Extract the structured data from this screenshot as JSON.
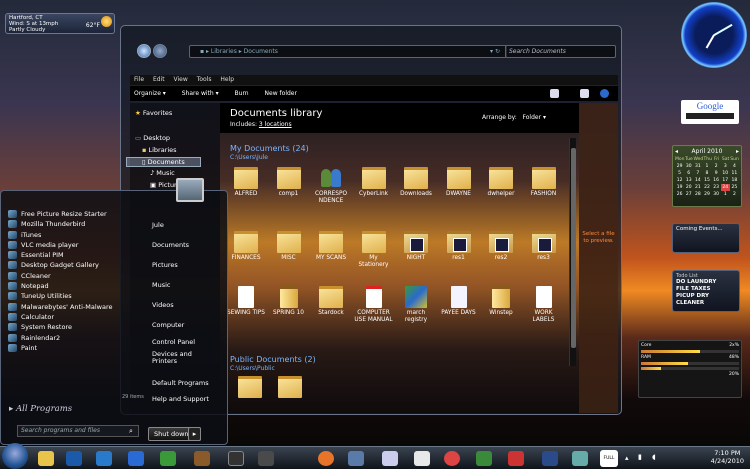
{
  "weather": {
    "city": "Hartford, CT",
    "wind": "Wind: S at 13mph",
    "condition": "Partly Cloudy",
    "temp": "62°F"
  },
  "google": {
    "label": "Google"
  },
  "calendar": {
    "month": "April  2010",
    "dow": [
      "Mon",
      "Tue",
      "Wed",
      "Thu",
      "Fri",
      "Sat",
      "Sun"
    ],
    "rows": [
      [
        "29",
        "30",
        "31",
        "1",
        "2",
        "3",
        "4"
      ],
      [
        "5",
        "6",
        "7",
        "8",
        "9",
        "10",
        "11"
      ],
      [
        "12",
        "13",
        "14",
        "15",
        "16",
        "17",
        "18"
      ],
      [
        "19",
        "20",
        "21",
        "22",
        "23",
        "24",
        "25"
      ],
      [
        "26",
        "27",
        "28",
        "29",
        "30",
        "1",
        "2"
      ]
    ],
    "today": "24"
  },
  "coming": {
    "title": "Coming Events..."
  },
  "todo": {
    "title": "Todo List",
    "items": [
      "DO LAUNDRY",
      "FILE TAXES",
      "PICUP DRY CLEANER"
    ]
  },
  "meter": {
    "cpu_label": "Core",
    "cpu_value": "2x%",
    "ram_label": "RAM",
    "ram_value": "48%",
    "disk_value": "20%",
    "cpu_level": 0.6,
    "ram_level": 0.48,
    "disk_level": 0.2
  },
  "explorer": {
    "address": [
      "Libraries",
      "Documents"
    ],
    "search_placeholder": "Search Documents",
    "menu": [
      "File",
      "Edit",
      "View",
      "Tools",
      "Help"
    ],
    "toolbar": [
      "Organize ▾",
      "Share with ▾",
      "Burn",
      "New folder"
    ],
    "nav": {
      "favorites": "Favorites",
      "desktop": "Desktop",
      "libraries": "Libraries",
      "documents": "Documents",
      "music": "Music",
      "pictures": "Pictur"
    },
    "library_title": "Documents library",
    "library_sub": "Includes:",
    "library_locations": "3 locations",
    "arrange_label": "Arrange by:",
    "arrange_value": "Folder",
    "section1": "My Documents (24)",
    "path1": "C:\\Users\\Jule",
    "section2": "Public Documents (2)",
    "path2": "C:\\Users\\Public",
    "files": [
      {
        "name": "ALFRED",
        "kind": "folder"
      },
      {
        "name": "comp1",
        "kind": "folder"
      },
      {
        "name": "CORRESPO NDENCE",
        "kind": "ppl"
      },
      {
        "name": "CyberLink",
        "kind": "folder"
      },
      {
        "name": "Downloads",
        "kind": "folder"
      },
      {
        "name": "DWAYNE",
        "kind": "folder"
      },
      {
        "name": "dwhelper",
        "kind": "folder"
      },
      {
        "name": "FASHION",
        "kind": "folder"
      },
      {
        "name": "FINANCES",
        "kind": "folder"
      },
      {
        "name": "MISC",
        "kind": "folder"
      },
      {
        "name": "MY SCANS",
        "kind": "folder"
      },
      {
        "name": "My Stationery",
        "kind": "folder"
      },
      {
        "name": "NIGHT",
        "kind": "vid"
      },
      {
        "name": "res1",
        "kind": "vid"
      },
      {
        "name": "res2",
        "kind": "vid"
      },
      {
        "name": "res3",
        "kind": "vid"
      },
      {
        "name": "SEWING TIPS",
        "kind": "doc"
      },
      {
        "name": "SPRING 10",
        "kind": "zip"
      },
      {
        "name": "Stardock",
        "kind": "folder"
      },
      {
        "name": "COMPUTER USE MANUAL",
        "kind": "pdf"
      },
      {
        "name": "march registry",
        "kind": "prog"
      },
      {
        "name": "PAYEE DAYS",
        "kind": "pay"
      },
      {
        "name": "Winstep",
        "kind": "zip"
      },
      {
        "name": "WORK LABELS",
        "kind": "doc"
      }
    ],
    "preview": "Select a file to preview.",
    "status": "29 items"
  },
  "start": {
    "pinned": [
      "Free Picture Resize Starter",
      "Mozilla Thunderbird",
      "iTunes",
      "VLC media player",
      "Essential PIM",
      "Desktop Gadget Gallery",
      "CCleaner",
      "Notepad",
      "TuneUp Utilities",
      "Malwarebytes' Anti-Malware",
      "Calculator",
      "System Restore",
      "Rainlendar2",
      "Paint"
    ],
    "all_programs": "All Programs",
    "search_placeholder": "Search programs and files",
    "right": [
      "Jule",
      "Documents",
      "Pictures",
      "Music",
      "Videos",
      "Computer",
      "Control Panel",
      "Devices and Printers",
      "Default Programs",
      "Help and Support"
    ],
    "shutdown": "Shut down"
  },
  "taskbar": {
    "time": "7:10 PM",
    "date": "4/24/2010",
    "full_label": "FULL"
  }
}
